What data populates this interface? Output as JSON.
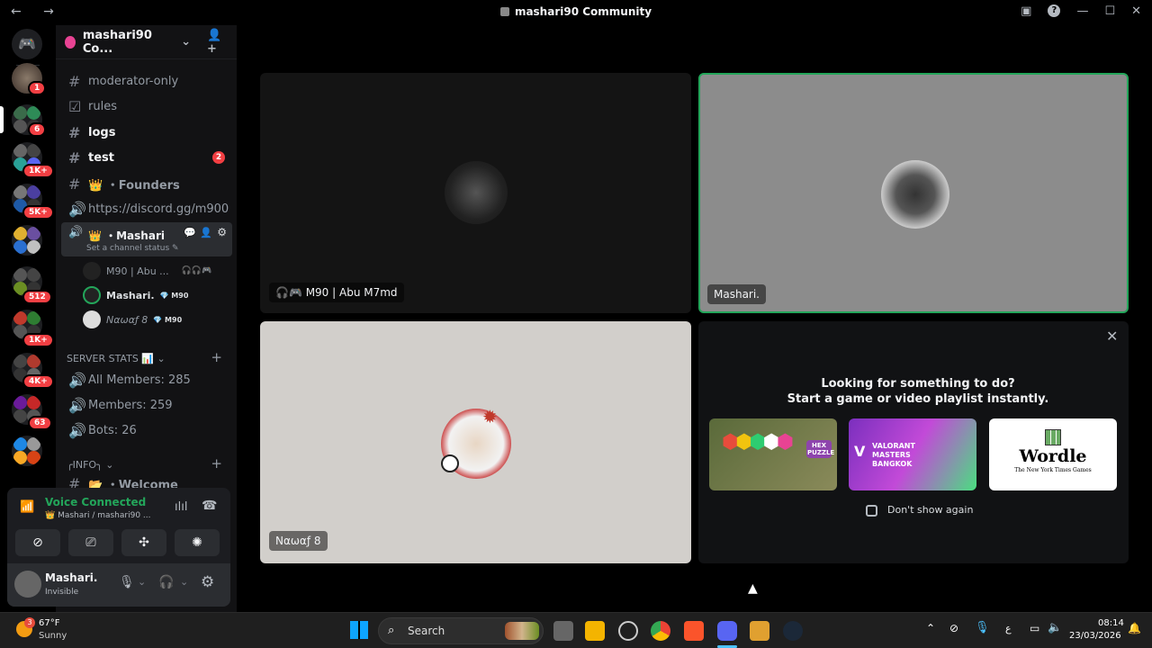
{
  "window": {
    "title": "mashari90 Community",
    "nav": "← →"
  },
  "server_rail": {
    "badges": [
      "1",
      "6",
      "1K+",
      "5K+",
      "512",
      "1K+",
      "4K+",
      "63"
    ]
  },
  "sidebar": {
    "server_name": "mashari90 Co...",
    "channels": [
      {
        "name": "moderator-only"
      },
      {
        "name": "rules"
      },
      {
        "name": "logs"
      },
      {
        "name": "test",
        "count": "2"
      },
      {
        "name": "👑 ・Founders"
      },
      {
        "name": "https://discord.gg/m900"
      },
      {
        "name": "👑 ・Mashari",
        "status": "Set a channel status ✎"
      }
    ],
    "voice_users": [
      {
        "name": "M90 | Abu ...",
        "tag": ""
      },
      {
        "name": "Mashari.",
        "tag": "💎 M90"
      },
      {
        "name": "Nαωαƒ 8",
        "tag": "💎 M90"
      }
    ],
    "category_stats": "SERVER STATS 📊",
    "stats": [
      "All Members: 285",
      "Members: 259",
      "Bots: 26"
    ],
    "category_info": "╭INFO╮",
    "partial_channel": "📂 ・Welcome"
  },
  "voice_panel": {
    "status": "Voice Connected",
    "location": "👑 Mashari / mashari90 ..."
  },
  "user": {
    "name": "Mashari.",
    "status": "Invisible"
  },
  "tiles": [
    {
      "name": "🎧🎮 M90 | Abu M7md"
    },
    {
      "name": "Mashari."
    },
    {
      "name": "Nαωαƒ 8"
    }
  ],
  "activity": {
    "headline": "Looking for something to do?",
    "subline": "Start a game or video playlist instantly.",
    "games": [
      "HEX PUZZLE",
      "VALORANT MASTERS BANGKOK",
      "Wordle"
    ],
    "wordle_sub": "The New York Times Games",
    "dont_show": "Don't show again"
  },
  "taskbar": {
    "temp": "67°F",
    "weather": "Sunny",
    "search": "Search",
    "time": "08:14",
    "date": "23/03/2026",
    "lang": "ع",
    "weather_badge": "3"
  }
}
